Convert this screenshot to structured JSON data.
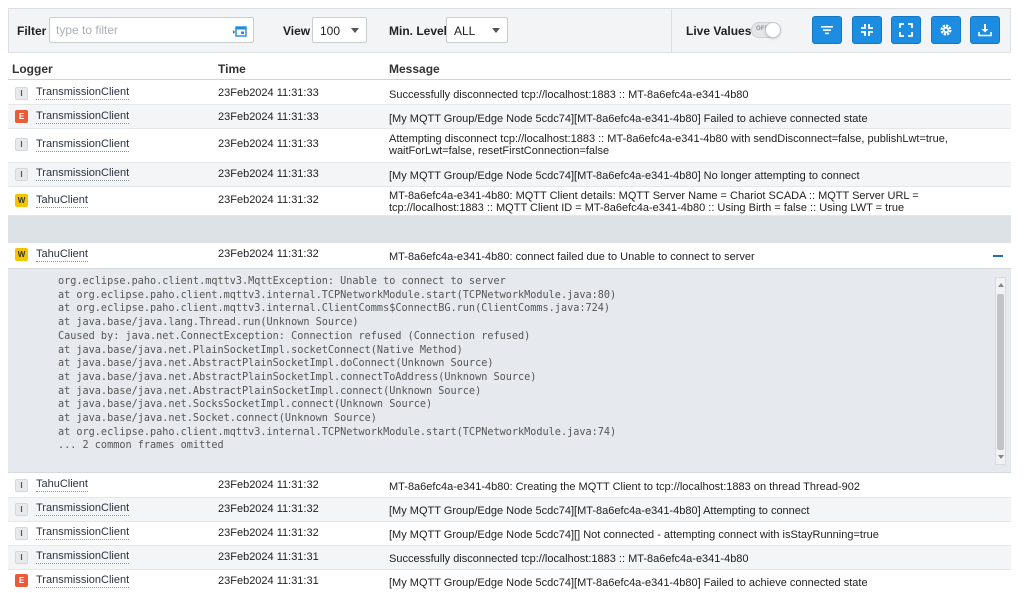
{
  "toolbar": {
    "filter_label": "Filter",
    "filter_placeholder": "type to filter",
    "view_label": "View",
    "view_value": "100",
    "level_label": "Min. Level",
    "level_value": "ALL",
    "live_label": "Live Values",
    "toggle_text": "OFF",
    "accent_color": "#1c8de0",
    "buttons": [
      "filter-icon",
      "compress-icon",
      "expand-icon",
      "gear-icon",
      "download-icon"
    ]
  },
  "columns": {
    "logger": "Logger",
    "time": "Time",
    "message": "Message"
  },
  "level_colors": {
    "I": "#e7e9eb",
    "E": "#e85c3a",
    "W": "#f3c500"
  },
  "rows": [
    {
      "level": "I",
      "logger": "TransmissionClient",
      "time": "23Feb2024 11:31:33",
      "message": "Successfully disconnected tcp://localhost:1883 :: MT-8a6efc4a-e341-4b80"
    },
    {
      "level": "E",
      "logger": "TransmissionClient",
      "time": "23Feb2024 11:31:33",
      "message": "[My MQTT Group/Edge Node 5cdc74][MT-8a6efc4a-e341-4b80] Failed to achieve connected state"
    },
    {
      "level": "I",
      "logger": "TransmissionClient",
      "time": "23Feb2024 11:31:33",
      "message": "Attempting disconnect tcp://localhost:1883 :: MT-8a6efc4a-e341-4b80 with sendDisconnect=false, publishLwt=true, waitForLwt=false, resetFirstConnection=false"
    },
    {
      "level": "I",
      "logger": "TransmissionClient",
      "time": "23Feb2024 11:31:33",
      "message": "[My MQTT Group/Edge Node 5cdc74][MT-8a6efc4a-e341-4b80] No longer attempting to connect"
    },
    {
      "level": "W",
      "logger": "TahuClient",
      "time": "23Feb2024 11:31:32",
      "message": "MT-8a6efc4a-e341-4b80: MQTT Client details: MQTT Server Name = Chariot SCADA :: MQTT Server URL = tcp://localhost:1883 :: MQTT Client ID = MT-8a6efc4a-e341-4b80 :: Using Birth = false :: Using LWT = true"
    },
    {
      "level": "W",
      "logger": "TahuClient",
      "time": "23Feb2024 11:31:32",
      "message": "MT-8a6efc4a-e341-4b80: connect failed due to Unable to connect to server"
    },
    {
      "level": "I",
      "logger": "TahuClient",
      "time": "23Feb2024 11:31:32",
      "message": "MT-8a6efc4a-e341-4b80: Creating the MQTT Client to tcp://localhost:1883 on thread Thread-902"
    },
    {
      "level": "I",
      "logger": "TransmissionClient",
      "time": "23Feb2024 11:31:32",
      "message": "[My MQTT Group/Edge Node 5cdc74][MT-8a6efc4a-e341-4b80] Attempting to connect"
    },
    {
      "level": "I",
      "logger": "TransmissionClient",
      "time": "23Feb2024 11:31:32",
      "message": "[My MQTT Group/Edge Node 5cdc74][] Not connected - attempting connect with isStayRunning=true"
    },
    {
      "level": "I",
      "logger": "TransmissionClient",
      "time": "23Feb2024 11:31:31",
      "message": "Successfully disconnected tcp://localhost:1883 :: MT-8a6efc4a-e341-4b80"
    },
    {
      "level": "E",
      "logger": "TransmissionClient",
      "time": "23Feb2024 11:31:31",
      "message": "[My MQTT Group/Edge Node 5cdc74][MT-8a6efc4a-e341-4b80] Failed to achieve connected state"
    }
  ],
  "stack_trace": "org.eclipse.paho.client.mqttv3.MqttException: Unable to connect to server\nat org.eclipse.paho.client.mqttv3.internal.TCPNetworkModule.start(TCPNetworkModule.java:80)\nat org.eclipse.paho.client.mqttv3.internal.ClientComms$ConnectBG.run(ClientComms.java:724)\nat java.base/java.lang.Thread.run(Unknown Source)\nCaused by: java.net.ConnectException: Connection refused (Connection refused)\nat java.base/java.net.PlainSocketImpl.socketConnect(Native Method)\nat java.base/java.net.AbstractPlainSocketImpl.doConnect(Unknown Source)\nat java.base/java.net.AbstractPlainSocketImpl.connectToAddress(Unknown Source)\nat java.base/java.net.AbstractPlainSocketImpl.connect(Unknown Source)\nat java.base/java.net.SocksSocketImpl.connect(Unknown Source)\nat java.base/java.net.Socket.connect(Unknown Source)\nat org.eclipse.paho.client.mqttv3.internal.TCPNetworkModule.start(TCPNetworkModule.java:74)\n... 2 common frames omitted"
}
